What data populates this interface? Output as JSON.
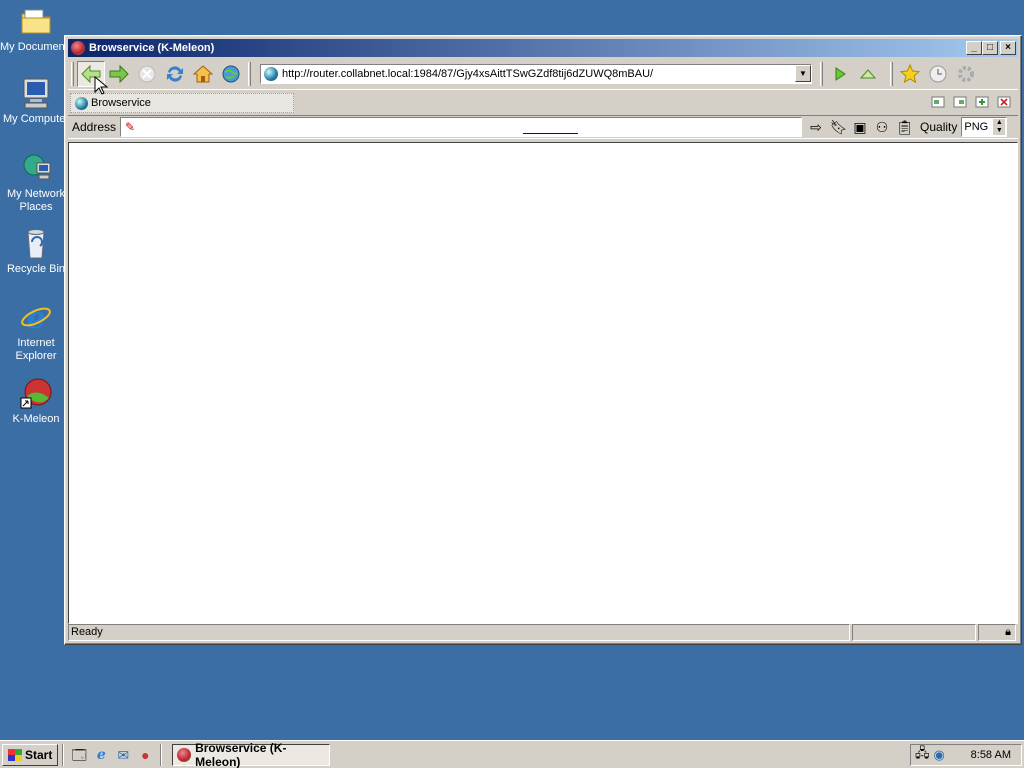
{
  "desktop": {
    "icons": [
      {
        "label": "My Documents",
        "icon": "folder-icon"
      },
      {
        "label": "My Computer",
        "icon": "computer-icon"
      },
      {
        "label": "My Network Places",
        "icon": "network-icon"
      },
      {
        "label": "Recycle Bin",
        "icon": "recycle-bin-icon"
      },
      {
        "label": "Internet Explorer",
        "icon": "ie-icon"
      },
      {
        "label": "K-Meleon",
        "icon": "kmeleon-icon"
      }
    ]
  },
  "window": {
    "title": "Browservice (K-Meleon)",
    "controls": {
      "minimize": "_",
      "maximize": "□",
      "close": "×"
    },
    "url": "http://router.collabnet.local:1984/87/Gjy4xsAittTSwGZdf8tij6dZUWQ8mBAU/",
    "tab_title": "Browservice",
    "address_label": "Address",
    "quality_label": "Quality",
    "quality_value": "PNG",
    "status_text": "Ready"
  },
  "taskbar": {
    "start_label": "Start",
    "task_label": "Browservice (K-Meleon)",
    "clock": "8:58 AM"
  },
  "colors": {
    "desktop": "#3a6ea5",
    "title_active": "#0a246a",
    "chrome": "#d4d0c8"
  }
}
